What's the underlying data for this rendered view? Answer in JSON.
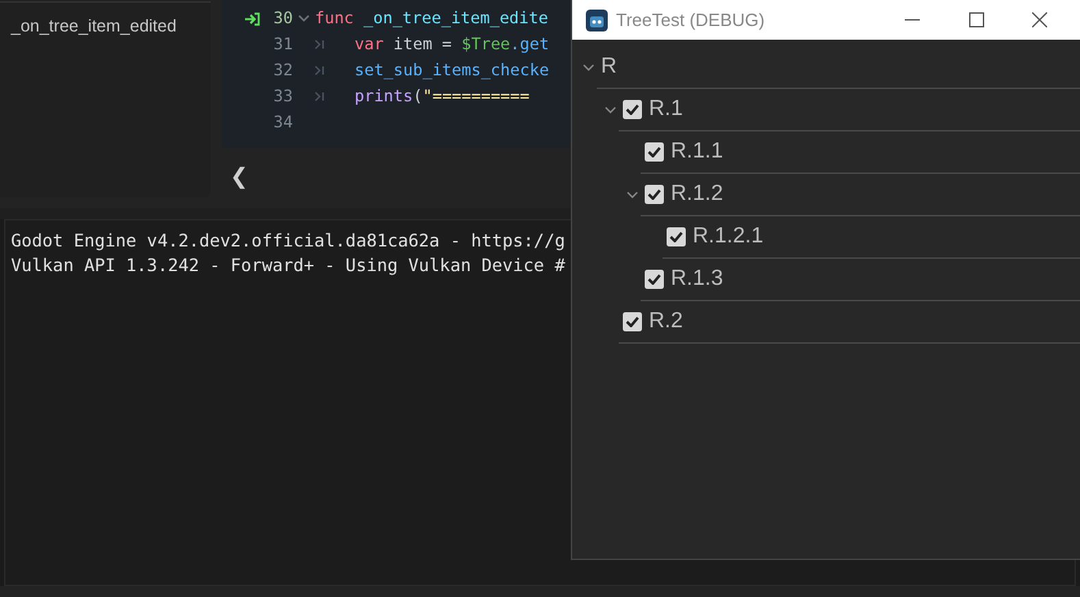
{
  "script_panel": {
    "method": "_on_tree_item_edited"
  },
  "editor": {
    "lines": [
      {
        "number": "30",
        "current": true,
        "tokens": [
          {
            "kind": "keyword",
            "text": "func"
          },
          {
            "kind": "funcname",
            "text": " _on_tree_item_edite"
          }
        ]
      },
      {
        "number": "31",
        "indent": true,
        "tokens": [
          {
            "kind": "keyword",
            "text": "var"
          },
          {
            "kind": "plain",
            "text": " item = "
          },
          {
            "kind": "node",
            "text": "$Tree"
          },
          {
            "kind": "call",
            "text": ".get"
          }
        ]
      },
      {
        "number": "32",
        "indent": true,
        "tokens": [
          {
            "kind": "call",
            "text": "set_sub_items_checke"
          }
        ]
      },
      {
        "number": "33",
        "indent": true,
        "tokens": [
          {
            "kind": "builtin",
            "text": "prints"
          },
          {
            "kind": "plain",
            "text": "("
          },
          {
            "kind": "string",
            "text": "\"=========="
          }
        ]
      },
      {
        "number": "34"
      }
    ],
    "scroll_left": "❮"
  },
  "output": {
    "lines": [
      "Godot Engine v4.2.dev2.official.da81ca62a - https://g",
      "Vulkan API 1.3.242 - Forward+ - Using Vulkan Device #"
    ]
  },
  "window": {
    "title": "TreeTest (DEBUG)"
  },
  "tree": {
    "root": {
      "label": "R",
      "expanded": true,
      "children": [
        {
          "label": "R.1",
          "checked": true,
          "expanded": true,
          "children": [
            {
              "label": "R.1.1",
              "checked": true
            },
            {
              "label": "R.1.2",
              "checked": true,
              "expanded": true,
              "children": [
                {
                  "label": "R.1.2.1",
                  "checked": true
                }
              ]
            },
            {
              "label": "R.1.3",
              "checked": true
            }
          ]
        },
        {
          "label": "R.2",
          "checked": true
        }
      ]
    }
  }
}
